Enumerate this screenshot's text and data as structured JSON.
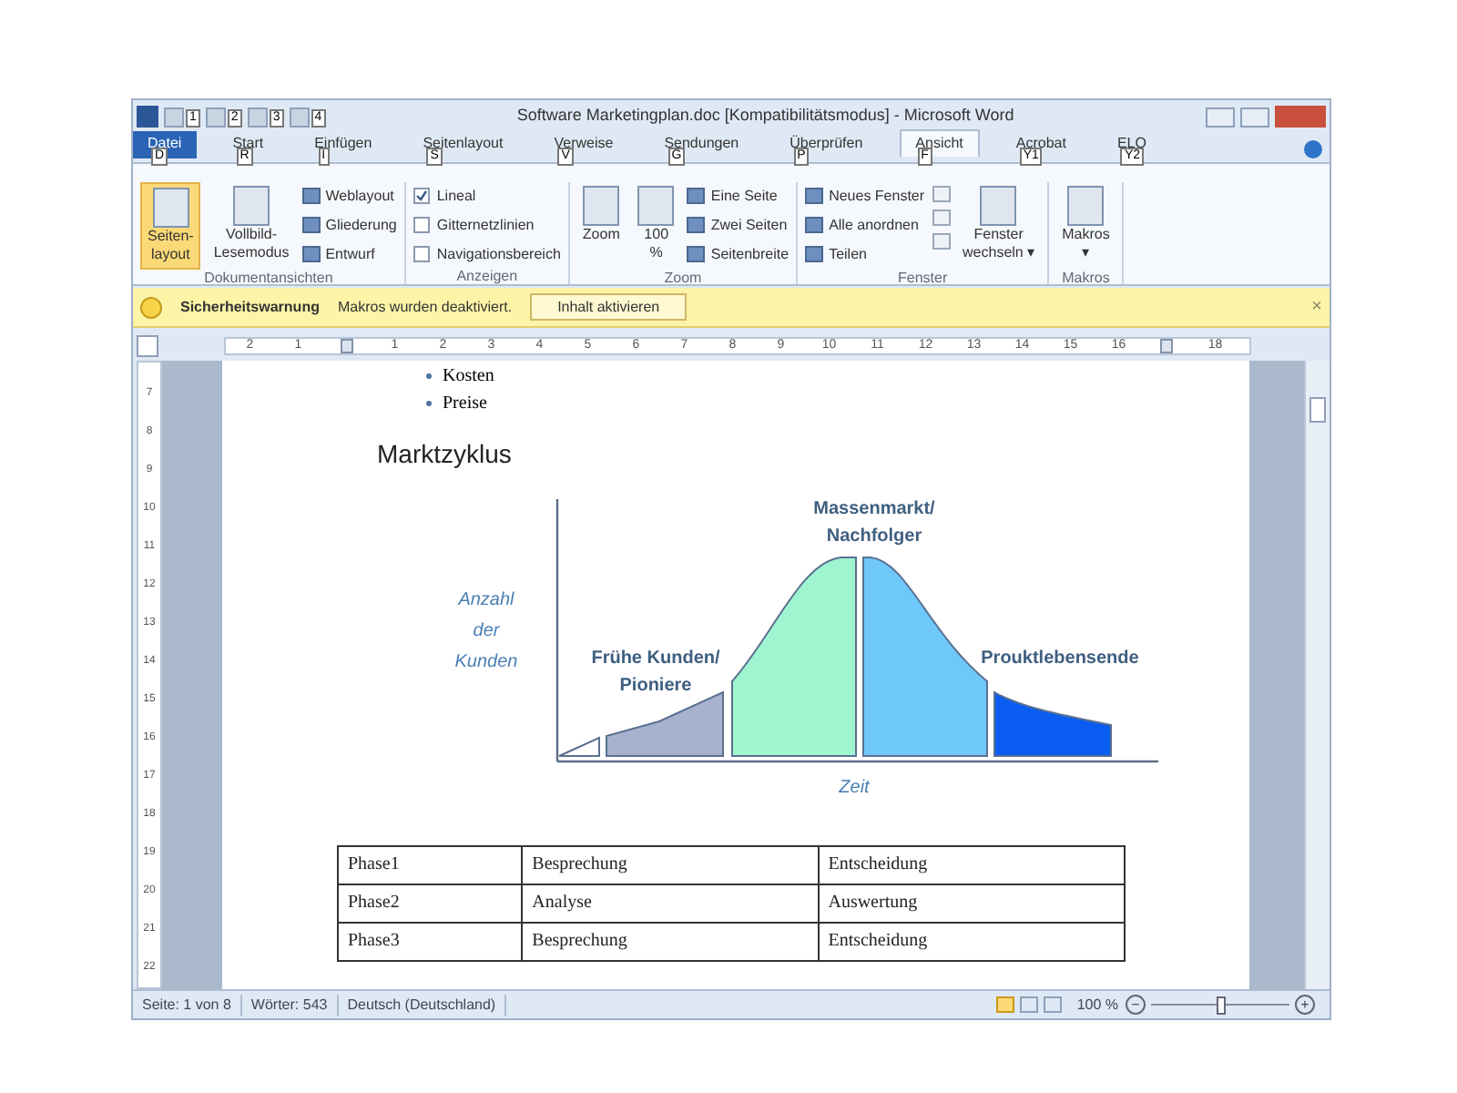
{
  "window": {
    "title": "Software Marketingplan.doc [Kompatibilitätsmodus] - Microsoft Word"
  },
  "quick_access": [
    {
      "keytip": "1"
    },
    {
      "keytip": "2"
    },
    {
      "keytip": "3"
    },
    {
      "keytip": "4"
    }
  ],
  "tabs": [
    {
      "label": "Datei",
      "keytip": "D",
      "kind": "file",
      "selected": false
    },
    {
      "label": "Start",
      "keytip": "R",
      "kind": "tab",
      "selected": false
    },
    {
      "label": "Einfügen",
      "keytip": "I",
      "kind": "tab",
      "selected": false
    },
    {
      "label": "Seitenlayout",
      "keytip": "S",
      "kind": "tab",
      "selected": false
    },
    {
      "label": "Verweise",
      "keytip": "V",
      "kind": "tab",
      "selected": false
    },
    {
      "label": "Sendungen",
      "keytip": "G",
      "kind": "tab",
      "selected": false
    },
    {
      "label": "Überprüfen",
      "keytip": "P",
      "kind": "tab",
      "selected": false
    },
    {
      "label": "Ansicht",
      "keytip": "F",
      "kind": "tab",
      "selected": true
    },
    {
      "label": "Acrobat",
      "keytip": "Y1",
      "kind": "tab",
      "selected": false
    },
    {
      "label": "ELO",
      "keytip": "Y2",
      "kind": "tab",
      "selected": false
    }
  ],
  "ribbon": {
    "groups": [
      {
        "label": "Dokumentansichten",
        "items": [
          {
            "kind": "big",
            "label": "Seiten-\nlayout",
            "selected": true
          },
          {
            "kind": "big",
            "label": "Vollbild-\nLesemodus",
            "selected": false
          },
          {
            "kind": "stack",
            "items": [
              {
                "label": "Weblayout"
              },
              {
                "label": "Gliederung"
              },
              {
                "label": "Entwurf"
              }
            ]
          }
        ]
      },
      {
        "label": "Anzeigen",
        "items": [
          {
            "kind": "checks",
            "items": [
              {
                "label": "Lineal",
                "checked": true
              },
              {
                "label": "Gitternetzlinien",
                "checked": false
              },
              {
                "label": "Navigationsbereich",
                "checked": false
              }
            ]
          }
        ]
      },
      {
        "label": "Zoom",
        "items": [
          {
            "kind": "big",
            "label": "Zoom",
            "selected": false
          },
          {
            "kind": "big",
            "label": "100\n%",
            "selected": false
          },
          {
            "kind": "stack",
            "items": [
              {
                "label": "Eine Seite"
              },
              {
                "label": "Zwei Seiten"
              },
              {
                "label": "Seitenbreite"
              }
            ]
          }
        ]
      },
      {
        "label": "Fenster",
        "items": [
          {
            "kind": "stack",
            "items": [
              {
                "label": "Neues Fenster"
              },
              {
                "label": "Alle anordnen"
              },
              {
                "label": "Teilen"
              }
            ]
          },
          {
            "kind": "icons"
          },
          {
            "kind": "big",
            "label": "Fenster\nwechseln ▾",
            "selected": false
          }
        ]
      },
      {
        "label": "Makros",
        "items": [
          {
            "kind": "big",
            "label": "Makros\n▾",
            "selected": false
          }
        ]
      }
    ]
  },
  "security_bar": {
    "title": "Sicherheitswarnung",
    "message": "Makros wurden deaktiviert.",
    "button": "Inhalt aktivieren",
    "close": "×"
  },
  "ruler": {
    "marks": [
      {
        "kind": "number",
        "text": "2"
      },
      {
        "kind": "number",
        "text": "1"
      },
      {
        "kind": "marker"
      },
      {
        "kind": "number",
        "text": "1"
      },
      {
        "kind": "number",
        "text": "2"
      },
      {
        "kind": "number",
        "text": "3"
      },
      {
        "kind": "number",
        "text": "4"
      },
      {
        "kind": "number",
        "text": "5"
      },
      {
        "kind": "number",
        "text": "6"
      },
      {
        "kind": "number",
        "text": "7"
      },
      {
        "kind": "number",
        "text": "8"
      },
      {
        "kind": "number",
        "text": "9"
      },
      {
        "kind": "number",
        "text": "10"
      },
      {
        "kind": "number",
        "text": "11"
      },
      {
        "kind": "number",
        "text": "12"
      },
      {
        "kind": "number",
        "text": "13"
      },
      {
        "kind": "number",
        "text": "14"
      },
      {
        "kind": "number",
        "text": "15"
      },
      {
        "kind": "number",
        "text": "16"
      },
      {
        "kind": "marker"
      },
      {
        "kind": "number",
        "text": "18"
      }
    ]
  },
  "vertical_ruler": [
    "7",
    "8",
    "9",
    "10",
    "11",
    "12",
    "13",
    "14",
    "15",
    "16",
    "17",
    "18",
    "19",
    "20",
    "21",
    "22"
  ],
  "document": {
    "bullets": [
      "Kosten",
      "Preise"
    ],
    "heading": "Marktzyklus",
    "diagram": {
      "y_label": [
        "Anzahl",
        "der",
        "Kunden"
      ],
      "x_label": "Zeit",
      "peak_label": [
        "Massenmarkt/",
        "Nachfolger"
      ],
      "early_label": [
        "Frühe Kunden/",
        "Pioniere"
      ],
      "end_label": "Prouktlebensende"
    },
    "table": {
      "rows": [
        [
          "Phase1",
          "Besprechung",
          "Entscheidung"
        ],
        [
          "Phase2",
          "Analyse",
          "Auswertung"
        ],
        [
          "Phase3",
          "Besprechung",
          "Entscheidung"
        ]
      ]
    }
  },
  "status_bar": {
    "items": [
      "Seite: 1 von 8",
      "Wörter: 543",
      "Deutsch (Deutschland)"
    ],
    "zoom": "100 %",
    "zoom_out": "−",
    "zoom_in": "+",
    "zoom_slider": {
      "level": 0.5
    }
  }
}
